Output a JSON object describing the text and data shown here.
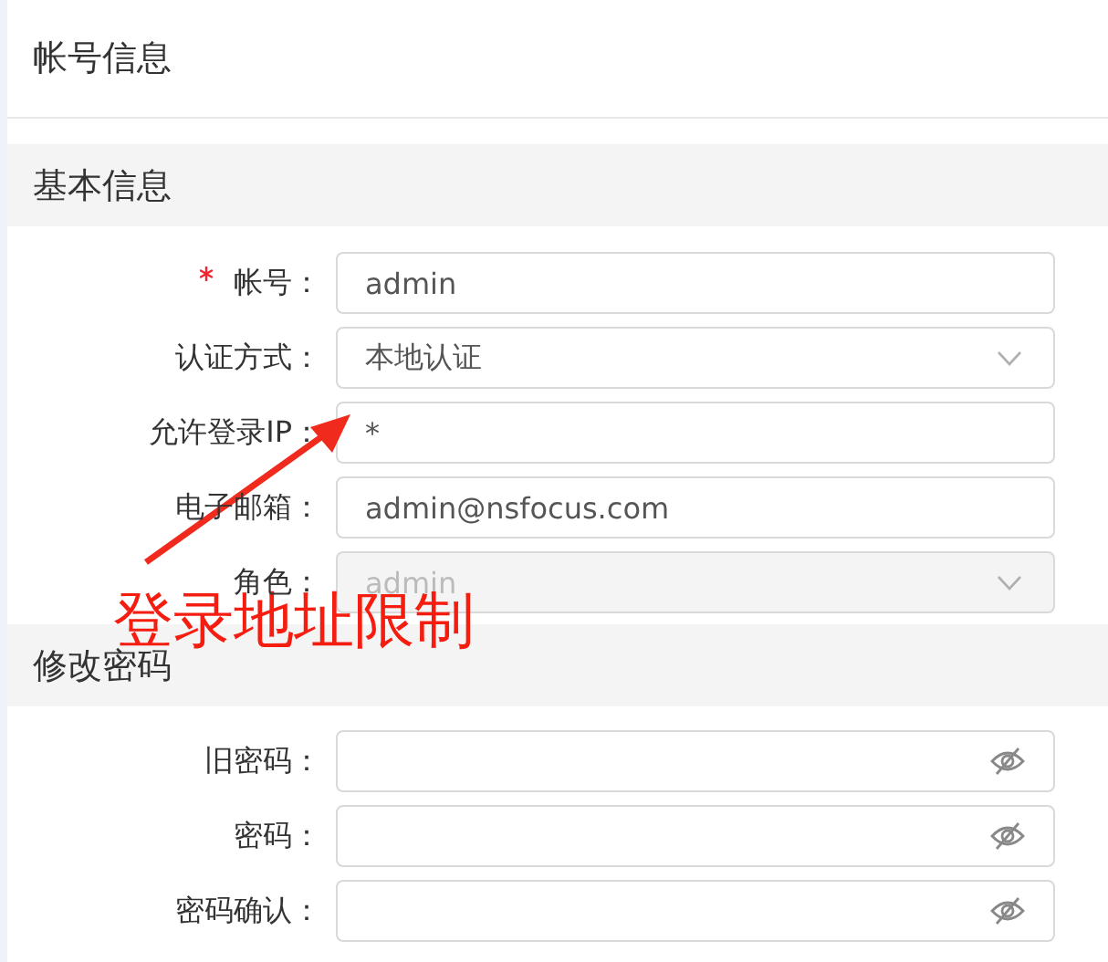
{
  "page": {
    "title": "帐号信息"
  },
  "sections": [
    {
      "title": "基本信息",
      "fields": [
        {
          "label": "帐号：",
          "kind": "text",
          "value": "admin",
          "required": true,
          "disabled": false
        },
        {
          "label": "认证方式：",
          "kind": "select",
          "value": "本地认证",
          "required": false,
          "disabled": false
        },
        {
          "label": "允许登录IP：",
          "kind": "text",
          "value": "*",
          "required": false,
          "disabled": false
        },
        {
          "label": "电子邮箱：",
          "kind": "text",
          "value": "admin@nsfocus.com",
          "required": false,
          "disabled": false
        },
        {
          "label": "角色：",
          "kind": "select",
          "value": "admin",
          "required": false,
          "disabled": true
        }
      ]
    },
    {
      "title": "修改密码",
      "fields": [
        {
          "label": "旧密码：",
          "kind": "password",
          "required": false,
          "disabled": false
        },
        {
          "label": "密码：",
          "kind": "password",
          "required": false,
          "disabled": false
        },
        {
          "label": "密码确认：",
          "kind": "password",
          "required": false,
          "disabled": false
        }
      ]
    }
  ],
  "annotation": {
    "text": "登录地址限制"
  }
}
